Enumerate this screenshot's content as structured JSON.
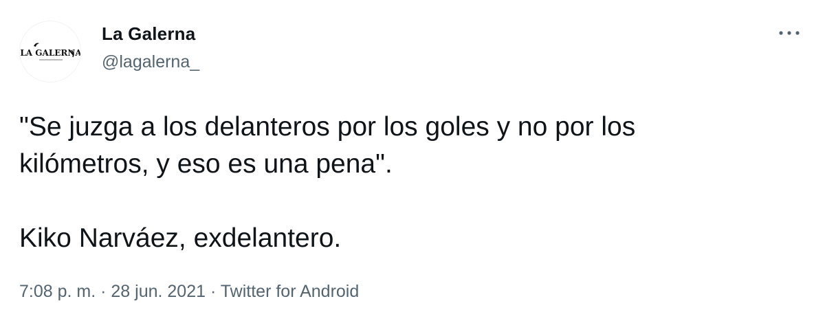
{
  "author": {
    "display_name": "La Galerna",
    "handle": "@lagalerna_",
    "avatar_logo_text": "LA GALERNA",
    "avatar_icon": "la-galerna-logo"
  },
  "header": {
    "more_icon": "more-horizontal-icon"
  },
  "tweet": {
    "lines": [
      "\"Se juzga a los delanteros por los goles y no por los",
      "kilómetros, y eso es una pena\".",
      "Kiko Narváez, exdelantero."
    ]
  },
  "meta": {
    "time": "7:08 p. m.",
    "separator": " · ",
    "date": "28 jun. 2021",
    "source": "Twitter for Android"
  },
  "colors": {
    "text_primary": "#0f1419",
    "text_secondary": "#536471",
    "background": "#ffffff"
  }
}
